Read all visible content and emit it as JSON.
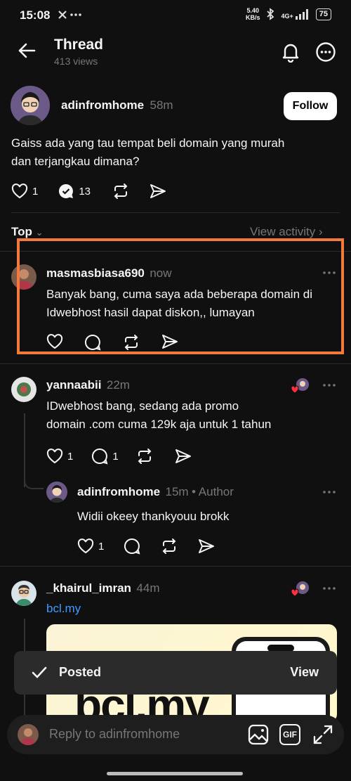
{
  "status_bar": {
    "time": "15:08",
    "net_speed_value": "5.40",
    "net_speed_unit": "KB/s",
    "network": "4G+",
    "battery": "75"
  },
  "header": {
    "title": "Thread",
    "views": "413 views"
  },
  "op": {
    "username": "adinfromhome",
    "time": "58m",
    "follow_label": "Follow",
    "text_line1": "Gaiss ada yang tau tempat beli domain yang murah",
    "text_line2": "dan terjangkau dimana?",
    "likes": "1",
    "replies": "13"
  },
  "sort": {
    "label": "Top",
    "view_activity": "View activity"
  },
  "replies": [
    {
      "username": "masmasbiasa690",
      "time": "now",
      "line1": "Banyak bang, cuma saya ada beberapa domain di",
      "line2": "Idwebhost hasil dapat diskon,, lumayan"
    },
    {
      "username": "yannaabii",
      "time": "22m",
      "line1": "IDwebhost bang, sedang ada promo",
      "line2": "domain .com cuma 129k aja untuk 1 tahun",
      "likes": "1",
      "replies": "1"
    },
    {
      "username": "adinfromhome",
      "time": "15m",
      "author_tag": "Author",
      "line1": "Widii okeey thankyouu brokk",
      "likes": "1"
    },
    {
      "username": "_khairul_imran",
      "time": "44m",
      "link": "bcl.my",
      "card_brand": "bcl.my"
    }
  ],
  "toast": {
    "label": "Posted",
    "action": "View"
  },
  "reply_bar": {
    "placeholder": "Reply to adinfromhome",
    "gif_label": "GIF"
  },
  "colors": {
    "background": "#101010",
    "highlight": "#f47a3b",
    "link": "#3b9dff",
    "heart": "#ff3040"
  }
}
